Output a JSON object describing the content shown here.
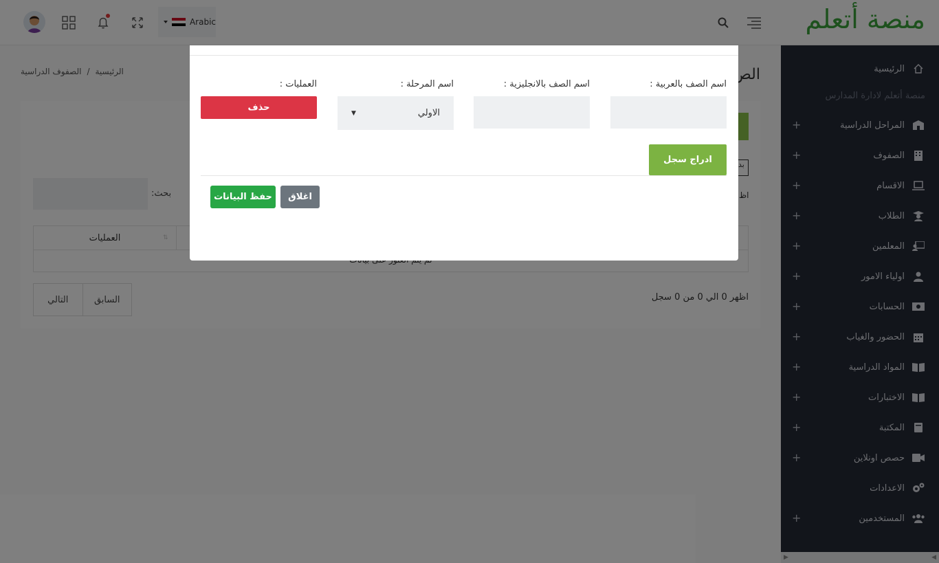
{
  "header": {
    "logo": "منصة أتعلم",
    "language": "Arabic",
    "icons": [
      "avatar",
      "apps-grid-icon",
      "bell-icon",
      "fullscreen-icon",
      "search-icon",
      "menu-icon"
    ],
    "flag_colors": [
      "#ce1126",
      "#ffffff",
      "#000000"
    ]
  },
  "sidebar": {
    "items": [
      {
        "label": "الرئيسية",
        "icon": "home-icon",
        "expandable": false
      },
      {
        "label": "المراحل الدراسية",
        "icon": "school-icon",
        "expandable": true
      },
      {
        "label": "الصفوف",
        "icon": "building-icon",
        "expandable": true
      },
      {
        "label": "الاقسام",
        "icon": "laptop-icon",
        "expandable": true
      },
      {
        "label": "الطلاب",
        "icon": "graduate-icon",
        "expandable": true
      },
      {
        "label": "المعلمين",
        "icon": "teacher-icon",
        "expandable": true
      },
      {
        "label": "اولياء الامور",
        "icon": "parent-icon",
        "expandable": true
      },
      {
        "label": "الحسابات",
        "icon": "money-icon",
        "expandable": true
      },
      {
        "label": "الحضور والغياب",
        "icon": "calendar-icon",
        "expandable": true
      },
      {
        "label": "المواد الدراسية",
        "icon": "book-icon",
        "expandable": true
      },
      {
        "label": "الاختبارات",
        "icon": "book-open-icon",
        "expandable": true
      },
      {
        "label": "المكتبة",
        "icon": "library-icon",
        "expandable": true
      },
      {
        "label": "حصص اونلاين",
        "icon": "video-icon",
        "expandable": true
      },
      {
        "label": "الاعدادات",
        "icon": "cogs-icon",
        "expandable": false
      },
      {
        "label": "المستخدمين",
        "icon": "users-icon",
        "expandable": true
      }
    ],
    "subtitle": "منصة أتعلم لادارة المدارس",
    "plus": "+",
    "scroll_left": "◀",
    "scroll_right": "▶"
  },
  "page": {
    "title": "الص",
    "breadcrumb": {
      "home": "الرئيسية",
      "sep": "/",
      "current": "الصفوف الدراسية"
    },
    "add_fragment": "بد",
    "show_fragment": "اظ",
    "search_label": "بحث:",
    "table_header_ops": "العمليات",
    "sort_icon": "⇅",
    "empty_text": "لم يتم العثور على بيانات",
    "info_text": "اظهر 0 الي 0 من 0 سجل",
    "pager_prev": "السابق",
    "pager_next": "التالي"
  },
  "modal": {
    "label_name_ar": "اسم الصف بالعربية :",
    "label_name_en": "اسم الصف بالانجليزية :",
    "label_stage": "اسم المرحلة :",
    "label_ops": "العمليات :",
    "stage_selected": "الاولي",
    "name_ar_value": "",
    "name_en_value": "",
    "delete_btn": "حذف",
    "insert_btn": "ادراج سجل",
    "save_btn": "حفظ البيانات",
    "close_btn": "اغلاق"
  }
}
